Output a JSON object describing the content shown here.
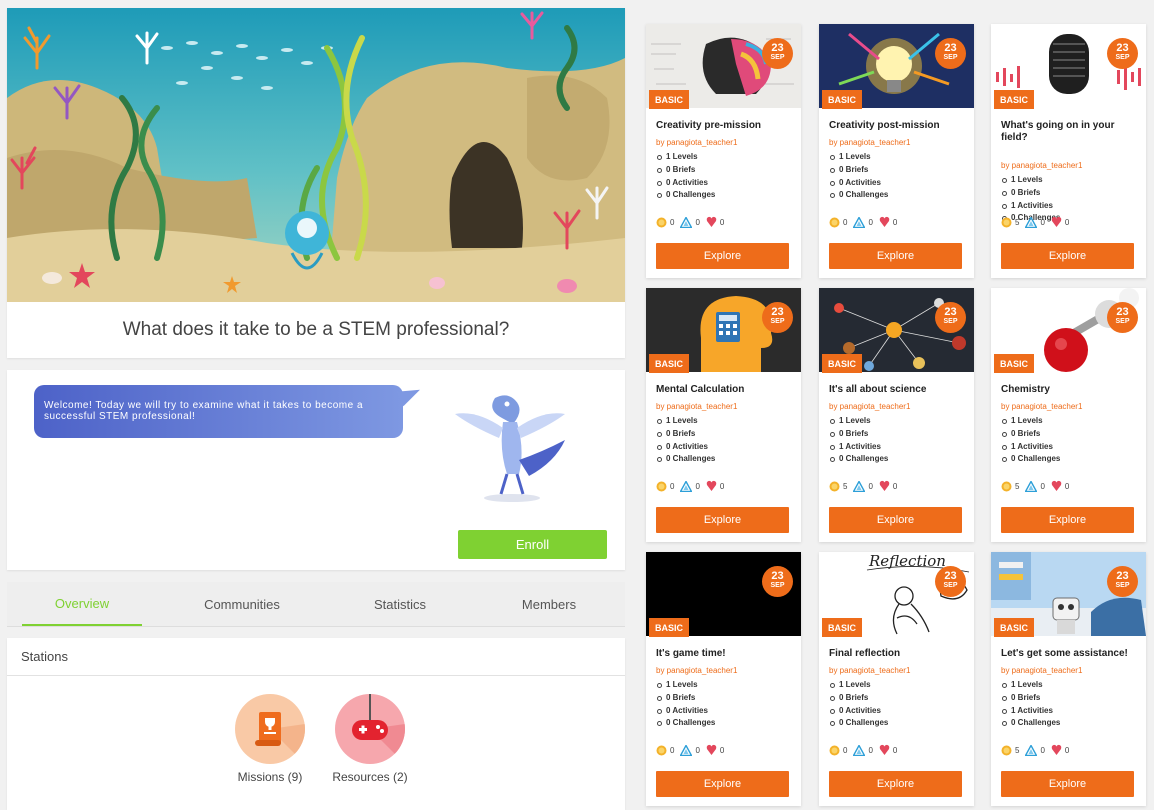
{
  "hero": {
    "title": "What does it take to be a STEM professional?"
  },
  "intro": {
    "speech": "Welcome! Today we will try to examine what it takes to become a successful STEM professional!",
    "enroll_label": "Enroll"
  },
  "tabs": [
    {
      "label": "Overview",
      "active": true
    },
    {
      "label": "Communities",
      "active": false
    },
    {
      "label": "Statistics",
      "active": false
    },
    {
      "label": "Members",
      "active": false
    }
  ],
  "stations": {
    "heading": "Stations",
    "items": [
      {
        "label": "Missions (9)",
        "icon": "scroll-trophy-icon"
      },
      {
        "label": "Resources (2)",
        "icon": "gamepad-icon"
      }
    ]
  },
  "colors": {
    "accent_orange": "#ee6c1a",
    "accent_green": "#7fd132",
    "bubble_start": "#4d62c8",
    "bubble_end": "#7e98e2"
  },
  "missions": [
    {
      "title": "Creativity pre-mission",
      "author": "by panagiota_teacher1",
      "level": "BASIC",
      "date_day": "23",
      "date_month": "SEP",
      "stats": [
        "1 Levels",
        "0 Briefs",
        "0 Activities",
        "0 Challenges"
      ],
      "coins": "0",
      "points": "0",
      "hearts": "0",
      "explore": "Explore"
    },
    {
      "title": "Creativity post-mission",
      "author": "by panagiota_teacher1",
      "level": "BASIC",
      "date_day": "23",
      "date_month": "SEP",
      "stats": [
        "1 Levels",
        "0 Briefs",
        "0 Activities",
        "0 Challenges"
      ],
      "coins": "0",
      "points": "0",
      "hearts": "0",
      "explore": "Explore"
    },
    {
      "title": "What's going on in your field?",
      "author": "by panagiota_teacher1",
      "level": "BASIC",
      "date_day": "23",
      "date_month": "SEP",
      "stats": [
        "1 Levels",
        "0 Briefs",
        "1 Activities",
        "0 Challenges"
      ],
      "coins": "5",
      "points": "0",
      "hearts": "0",
      "explore": "Explore"
    },
    {
      "title": "Mental Calculation",
      "author": "by panagiota_teacher1",
      "level": "BASIC",
      "date_day": "23",
      "date_month": "SEP",
      "stats": [
        "1 Levels",
        "0 Briefs",
        "0 Activities",
        "0 Challenges"
      ],
      "coins": "0",
      "points": "0",
      "hearts": "0",
      "explore": "Explore"
    },
    {
      "title": "It's all about science",
      "author": "by panagiota_teacher1",
      "level": "BASIC",
      "date_day": "23",
      "date_month": "SEP",
      "stats": [
        "1 Levels",
        "0 Briefs",
        "1 Activities",
        "0 Challenges"
      ],
      "coins": "5",
      "points": "0",
      "hearts": "0",
      "explore": "Explore"
    },
    {
      "title": "Chemistry",
      "author": "by panagiota_teacher1",
      "level": "BASIC",
      "date_day": "23",
      "date_month": "SEP",
      "stats": [
        "1 Levels",
        "0 Briefs",
        "1 Activities",
        "0 Challenges"
      ],
      "coins": "5",
      "points": "0",
      "hearts": "0",
      "explore": "Explore"
    },
    {
      "title": "It's game time!",
      "author": "by panagiota_teacher1",
      "level": "BASIC",
      "date_day": "23",
      "date_month": "SEP",
      "stats": [
        "1 Levels",
        "0 Briefs",
        "0 Activities",
        "0 Challenges"
      ],
      "coins": "0",
      "points": "0",
      "hearts": "0",
      "explore": "Explore"
    },
    {
      "title": "Final reflection",
      "author": "by panagiota_teacher1",
      "level": "BASIC",
      "date_day": "23",
      "date_month": "SEP",
      "stats": [
        "1 Levels",
        "0 Briefs",
        "0 Activities",
        "0 Challenges"
      ],
      "coins": "0",
      "points": "0",
      "hearts": "0",
      "explore": "Explore",
      "image_text": "Reflection"
    },
    {
      "title": "Let's get some assistance!",
      "author": "by panagiota_teacher1",
      "level": "BASIC",
      "date_day": "23",
      "date_month": "SEP",
      "stats": [
        "1 Levels",
        "0 Briefs",
        "1 Activities",
        "0 Challenges"
      ],
      "coins": "5",
      "points": "0",
      "hearts": "0",
      "explore": "Explore"
    }
  ]
}
